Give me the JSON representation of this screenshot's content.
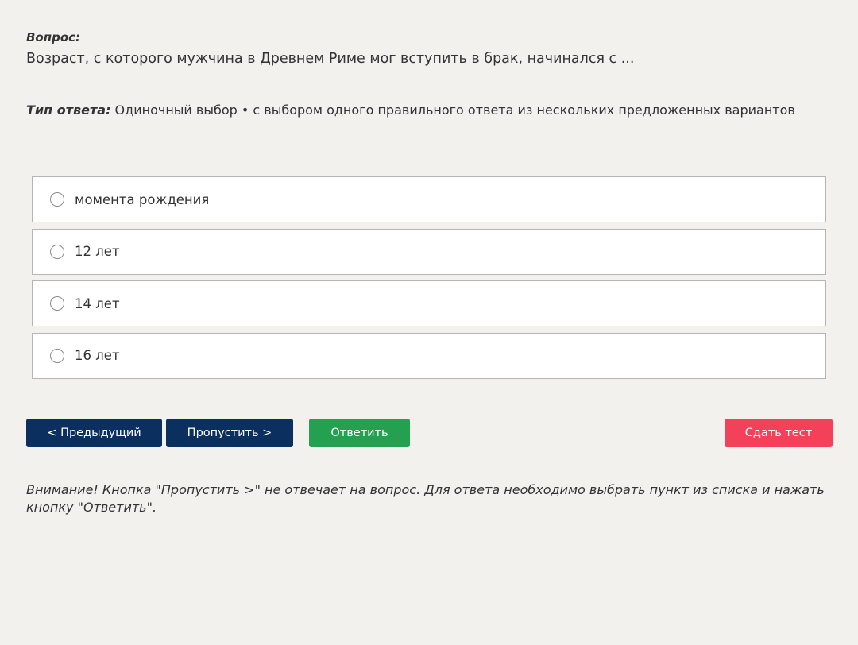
{
  "question": {
    "label": "Вопрос:",
    "text": "Возраст, с которого мужчина в Древнем Риме мог вступить в брак, начинался с ..."
  },
  "answer_type": {
    "label": "Тип ответа:",
    "value": " Одиночный выбор • с выбором одного правильного ответа из нескольких предложенных вариантов"
  },
  "options": [
    {
      "label": "момента рождения"
    },
    {
      "label": "12 лет"
    },
    {
      "label": "14 лет"
    },
    {
      "label": "16 лет"
    }
  ],
  "buttons": {
    "prev": "< Предыдущий",
    "skip": "Пропустить >",
    "answer": "Ответить",
    "submit": "Сдать тест"
  },
  "warning": "Внимание! Кнопка \"Пропустить >\" не отвечает на вопрос. Для ответа необходимо выбрать пункт из списка и нажать кнопку \"Ответить\".",
  "colors": {
    "background": "#f2f1ee",
    "nav_button": "#0b2f5e",
    "answer_button": "#23a050",
    "submit_button": "#f24158"
  }
}
